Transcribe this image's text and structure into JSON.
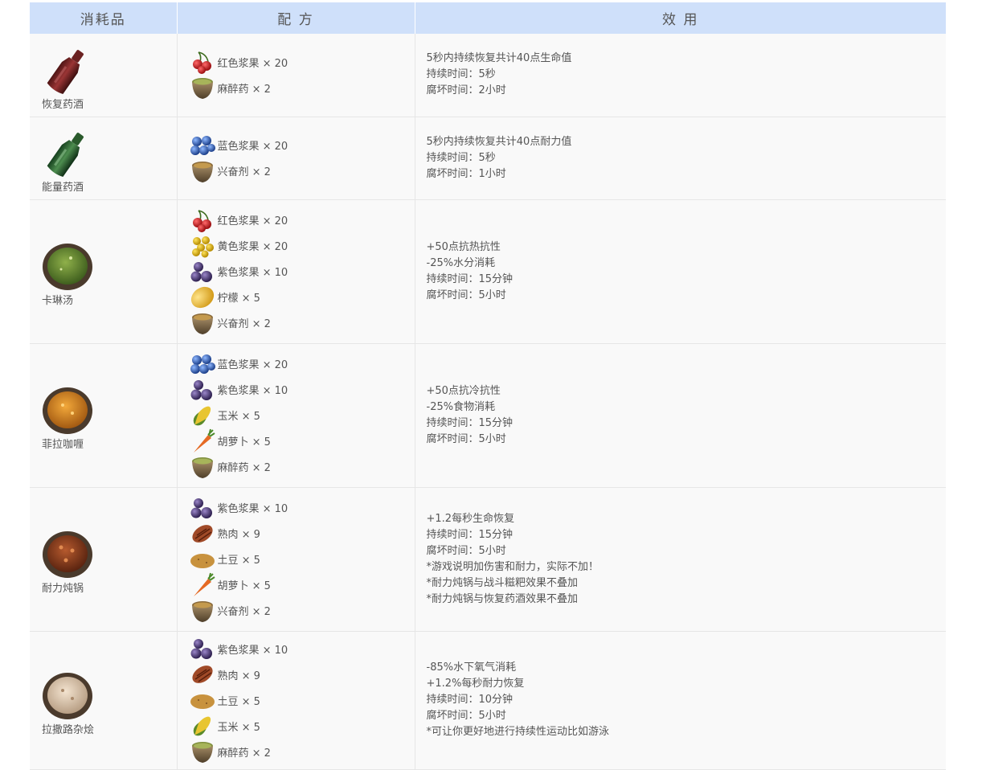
{
  "headers": {
    "item": "消耗品",
    "recipe": "配 方",
    "effect": "效 用"
  },
  "rows": [
    {
      "name": "恢复药酒",
      "icon": "red-potion-bottle-icon",
      "ingredients": [
        {
          "icon": "red-berry-icon",
          "label": "红色浆果 × 20"
        },
        {
          "icon": "narcotic-bowl-icon",
          "label": "麻醉药 × 2"
        }
      ],
      "effects": [
        "5秒内持续恢复共计40点生命值",
        "持续时间：5秒",
        "腐坏时间：2小时"
      ]
    },
    {
      "name": "能量药酒",
      "icon": "green-potion-bottle-icon",
      "ingredients": [
        {
          "icon": "blue-berry-icon",
          "label": "蓝色浆果 × 20"
        },
        {
          "icon": "stimulant-bowl-icon",
          "label": "兴奋剂 × 2"
        }
      ],
      "effects": [
        "5秒内持续恢复共计40点耐力值",
        "持续时间：5秒",
        "腐坏时间：1小时"
      ]
    },
    {
      "name": "卡琳汤",
      "icon": "green-soup-bowl-icon",
      "ingredients": [
        {
          "icon": "red-berry-icon",
          "label": "红色浆果 × 20"
        },
        {
          "icon": "yellow-berry-icon",
          "label": "黄色浆果 × 20"
        },
        {
          "icon": "purple-berry-icon",
          "label": "紫色浆果 × 10"
        },
        {
          "icon": "lemon-icon",
          "label": "柠檬 × 5"
        },
        {
          "icon": "stimulant-bowl-icon",
          "label": "兴奋剂 × 2"
        }
      ],
      "effects": [
        "+50点抗热抗性",
        "-25%水分消耗",
        "持续时间：15分钟",
        "腐坏时间：5小时"
      ]
    },
    {
      "name": "菲拉咖喱",
      "icon": "curry-bowl-icon",
      "ingredients": [
        {
          "icon": "blue-berry-icon",
          "label": "蓝色浆果 × 20"
        },
        {
          "icon": "purple-berry-icon",
          "label": "紫色浆果 × 10"
        },
        {
          "icon": "corn-icon",
          "label": "玉米 × 5"
        },
        {
          "icon": "carrot-icon",
          "label": "胡萝卜 × 5"
        },
        {
          "icon": "narcotic-bowl-icon",
          "label": "麻醉药 × 2"
        }
      ],
      "effects": [
        "+50点抗冷抗性",
        "-25%食物消耗",
        "持续时间：15分钟",
        "腐坏时间：5小时"
      ]
    },
    {
      "name": "耐力炖锅",
      "icon": "stew-bowl-icon",
      "ingredients": [
        {
          "icon": "purple-berry-icon",
          "label": "紫色浆果 × 10"
        },
        {
          "icon": "cooked-meat-icon",
          "label": "熟肉 × 9"
        },
        {
          "icon": "potato-icon",
          "label": "土豆 × 5"
        },
        {
          "icon": "carrot-icon",
          "label": "胡萝卜 × 5"
        },
        {
          "icon": "stimulant-bowl-icon",
          "label": "兴奋剂 × 2"
        }
      ],
      "effects": [
        "+1.2每秒生命恢复",
        "持续时间：15分钟",
        "腐坏时间：5小时",
        "*游戏说明加伤害和耐力，实际不加！",
        "*耐力炖锅与战斗糍粑效果不叠加",
        "*耐力炖锅与恢复药酒效果不叠加"
      ]
    },
    {
      "name": "拉撒路杂烩",
      "icon": "chowder-bowl-icon",
      "ingredients": [
        {
          "icon": "purple-berry-icon",
          "label": "紫色浆果 × 10"
        },
        {
          "icon": "cooked-meat-icon",
          "label": "熟肉 × 9"
        },
        {
          "icon": "potato-icon",
          "label": "土豆 × 5"
        },
        {
          "icon": "corn-icon",
          "label": "玉米 × 5"
        },
        {
          "icon": "narcotic-bowl-icon",
          "label": "麻醉药 × 2"
        }
      ],
      "effects": [
        "-85%水下氧气消耗",
        "+1.2%每秒耐力恢复",
        "持续时间：10分钟",
        "腐坏时间：5小时",
        "*可让你更好地进行持续性运动比如游泳"
      ]
    }
  ]
}
